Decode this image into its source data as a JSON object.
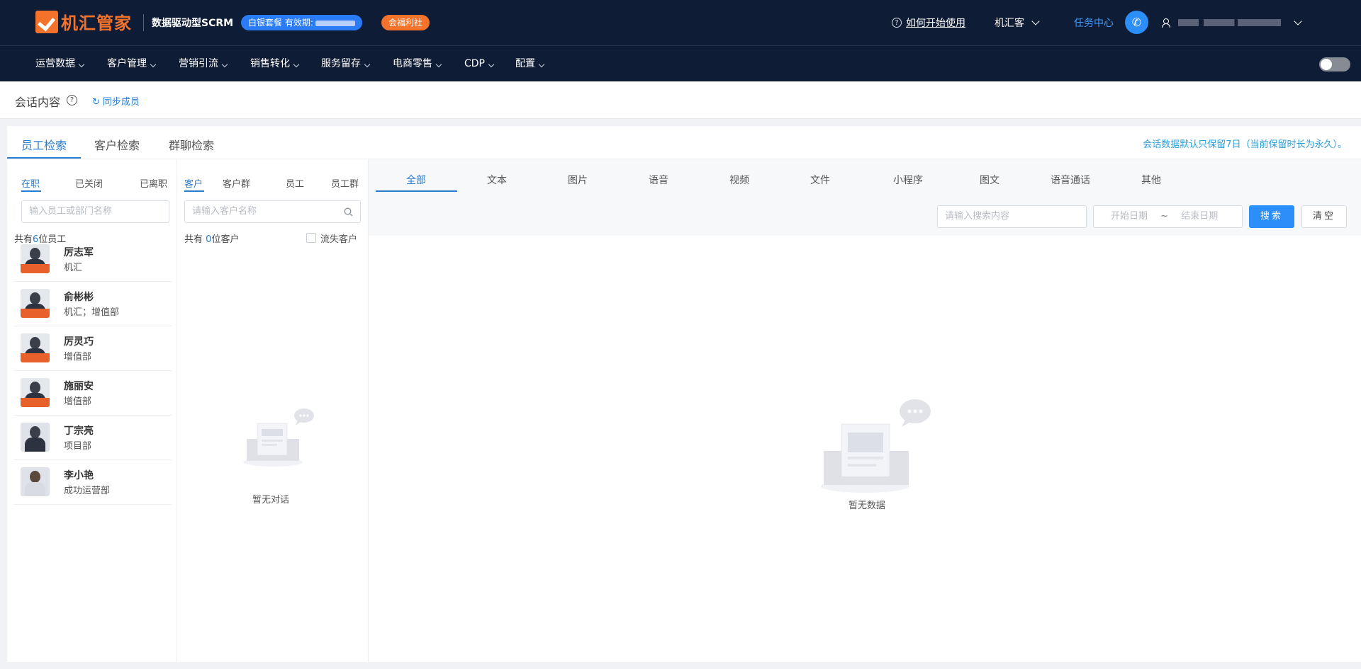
{
  "header": {
    "logo_text": "机汇管家",
    "subtitle": "数据驱动型SCRM",
    "plan_badge": "白银套餐 有效期:",
    "welfare_badge": "会福利社",
    "help_link": "如何开始使用",
    "brand_selector": "机汇客",
    "task_center": "任务中心"
  },
  "nav": {
    "items": [
      {
        "label": "运营数据"
      },
      {
        "label": "客户管理"
      },
      {
        "label": "营销引流"
      },
      {
        "label": "销售转化"
      },
      {
        "label": "服务留存"
      },
      {
        "label": "电商零售"
      },
      {
        "label": "CDP"
      },
      {
        "label": "配置"
      }
    ]
  },
  "subheader": {
    "title": "会话内容",
    "help_icon_glyph": "?",
    "sync_label": "同步成员"
  },
  "main_tabs": [
    "员工检索",
    "客户检索",
    "群聊检索"
  ],
  "retention_notice": "会话数据默认只保留7日（当前保留时长为永久）。",
  "employee_panel": {
    "tabs": [
      "在职",
      "已关闭",
      "已离职"
    ],
    "search_placeholder": "输入员工或部门名称",
    "count_prefix": "共有",
    "count_value": "6",
    "count_suffix": "位员工",
    "employees": [
      {
        "name": "厉志军",
        "dept": "机汇"
      },
      {
        "name": "俞彬彬",
        "dept": "机汇；增值部"
      },
      {
        "name": "厉灵巧",
        "dept": "增值部"
      },
      {
        "name": "施丽安",
        "dept": "增值部"
      },
      {
        "name": "丁宗亮",
        "dept": "项目部"
      },
      {
        "name": "李小艳",
        "dept": "成功运营部"
      }
    ]
  },
  "customer_panel": {
    "tabs": [
      "客户",
      "客户群",
      "员工",
      "员工群"
    ],
    "search_placeholder": "请输入客户名称",
    "count_prefix": "共有",
    "count_value": "0",
    "count_suffix": "位客户",
    "lost_checkbox": "流失客户",
    "empty_text": "暂无对话"
  },
  "message_panel": {
    "type_tabs": [
      "全部",
      "文本",
      "图片",
      "语音",
      "视频",
      "文件",
      "小程序",
      "图文",
      "语音通话",
      "其他"
    ],
    "search_placeholder": "请输入搜索内容",
    "start_date": "开始日期",
    "date_sep": "~",
    "end_date": "结束日期",
    "search_button": "搜索",
    "clear_button": "清空",
    "empty_text": "暂无数据"
  },
  "colors": {
    "topbar_bg": "#0f1c36",
    "brand_orange": "#f5722b",
    "accent_blue": "#2a7ccf",
    "primary_button": "#2c8ef8"
  }
}
